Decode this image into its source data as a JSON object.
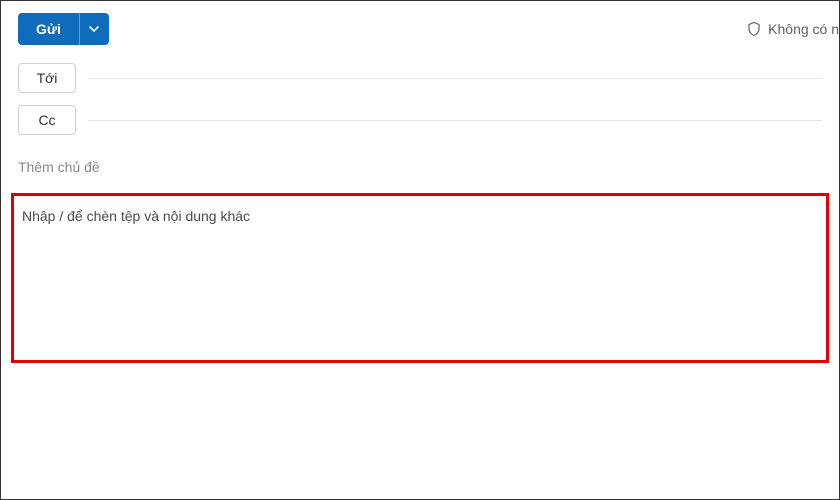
{
  "toolbar": {
    "send_label": "Gửi",
    "no_label_text": "Không có n"
  },
  "recipients": {
    "to_label": "Tới",
    "cc_label": "Cc"
  },
  "subject": {
    "placeholder": "Thêm chủ đề"
  },
  "body": {
    "placeholder": "Nhập / để chèn tệp và nội dung khác"
  },
  "icons": {
    "chevron_down": "chevron-down-icon",
    "shield": "shield-icon"
  },
  "colors": {
    "primary": "#0f6cbd",
    "highlight_border": "#e20000"
  }
}
